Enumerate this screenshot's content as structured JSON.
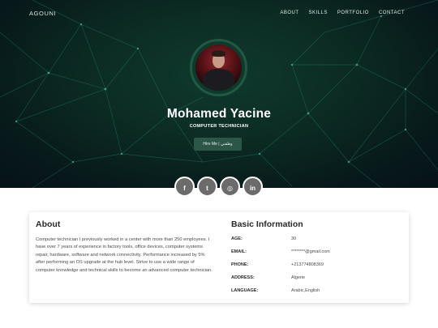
{
  "nav": {
    "brand": "AGOUNI",
    "items": [
      "ABOUT",
      "SKILLS",
      "PORTFOLIO",
      "CONTACT"
    ]
  },
  "hero": {
    "name": "Mohamed Yacine",
    "role": "COMPUTER TECHNICIAN",
    "hire_label": "Hire Me | وظفني"
  },
  "socials": [
    {
      "icon": "facebook-icon",
      "glyph": "f"
    },
    {
      "icon": "twitter-icon",
      "glyph": "t"
    },
    {
      "icon": "instagram-icon",
      "glyph": "◎"
    },
    {
      "icon": "linkedin-icon",
      "glyph": "in"
    }
  ],
  "about": {
    "title": "About",
    "text": "Computer technician I previously worked in a center with more than 250 employees. I have over 7 years of experience in factory tools, office devices, computer systems repair, hardware, software and network connectivity. Performance increased by 5% after performing an OS upgrade at the hub level. Strive to use a wide range of computer knowledge and technical skills to become an advanced computer technician."
  },
  "info": {
    "title": "Basic Information",
    "rows": [
      {
        "label": "AGE:",
        "value": "30"
      },
      {
        "label": "EMAIL:",
        "value": "********@gmail.com"
      },
      {
        "label": "PHONE:",
        "value": "+213774808369"
      },
      {
        "label": "ADDRESS:",
        "value": "Algerie"
      },
      {
        "label": "LANGUAGE:",
        "value": "Arabic,English"
      }
    ]
  },
  "colors": {
    "hero_bg": "#0b2a22",
    "hire_button": "#2c5647",
    "social_bg": "#6b6b6b"
  }
}
